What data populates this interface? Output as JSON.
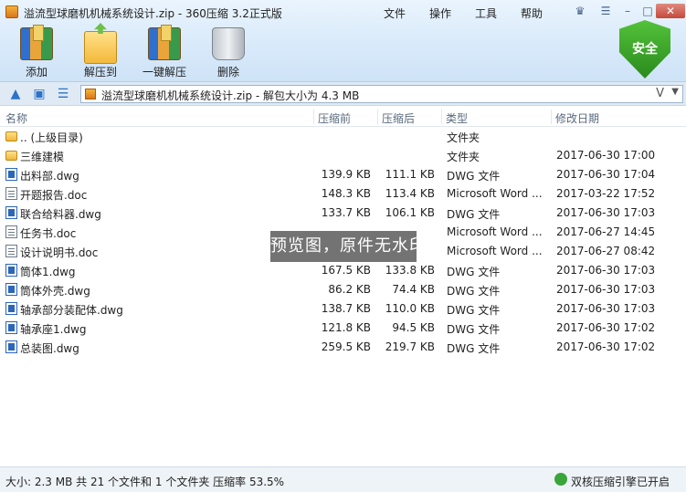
{
  "window": {
    "title": "溢流型球磨机机械系统设计.zip - 360压缩 3.2正式版",
    "menu": [
      "文件",
      "操作",
      "工具",
      "帮助"
    ]
  },
  "toolbar": {
    "add": "添加",
    "extract_to": "解压到",
    "one_click_extract": "一键解压",
    "delete": "删除",
    "security_badge": "安全"
  },
  "address": {
    "text": "溢流型球磨机机械系统设计.zip - 解包大小为 4.3 MB",
    "v_glyph": "V"
  },
  "columns": [
    "名称",
    "压缩前",
    "压缩后",
    "类型",
    "修改日期"
  ],
  "files": [
    {
      "name": ".. (上级目录)",
      "before": "",
      "after": "",
      "type": "文件夹",
      "date": "",
      "icon": "folder"
    },
    {
      "name": "三维建模",
      "before": "",
      "after": "",
      "type": "文件夹",
      "date": "2017-06-30 17:00",
      "icon": "folder"
    },
    {
      "name": "出料部.dwg",
      "before": "139.9 KB",
      "after": "111.1 KB",
      "type": "DWG 文件",
      "date": "2017-06-30 17:04",
      "icon": "dwg"
    },
    {
      "name": "开题报告.doc",
      "before": "148.3 KB",
      "after": "113.4 KB",
      "type": "Microsoft Word ...",
      "date": "2017-03-22 17:52",
      "icon": "doc"
    },
    {
      "name": "联合给料器.dwg",
      "before": "133.7 KB",
      "after": "106.1 KB",
      "type": "DWG 文件",
      "date": "2017-06-30 17:03",
      "icon": "dwg"
    },
    {
      "name": "任务书.doc",
      "before": "",
      "after": "",
      "type": "Microsoft Word ...",
      "date": "2017-06-27 14:45",
      "icon": "doc"
    },
    {
      "name": "设计说明书.doc",
      "before": "",
      "after": "",
      "type": "Microsoft Word ...",
      "date": "2017-06-27 08:42",
      "icon": "doc"
    },
    {
      "name": "筒体1.dwg",
      "before": "167.5 KB",
      "after": "133.8 KB",
      "type": "DWG 文件",
      "date": "2017-06-30 17:03",
      "icon": "dwg"
    },
    {
      "name": "筒体外壳.dwg",
      "before": "86.2 KB",
      "after": "74.4 KB",
      "type": "DWG 文件",
      "date": "2017-06-30 17:03",
      "icon": "dwg"
    },
    {
      "name": "轴承部分装配体.dwg",
      "before": "138.7 KB",
      "after": "110.0 KB",
      "type": "DWG 文件",
      "date": "2017-06-30 17:03",
      "icon": "dwg"
    },
    {
      "name": "轴承座1.dwg",
      "before": "121.8 KB",
      "after": "94.5 KB",
      "type": "DWG 文件",
      "date": "2017-06-30 17:02",
      "icon": "dwg"
    },
    {
      "name": "总装图.dwg",
      "before": "259.5 KB",
      "after": "219.7 KB",
      "type": "DWG 文件",
      "date": "2017-06-30 17:02",
      "icon": "dwg"
    }
  ],
  "watermark": "预览图，原件无水印",
  "status": {
    "left": "大小: 2.3 MB 共 21 个文件和 1 个文件夹 压缩率 53.5%",
    "right": "双核压缩引擎已开启"
  }
}
